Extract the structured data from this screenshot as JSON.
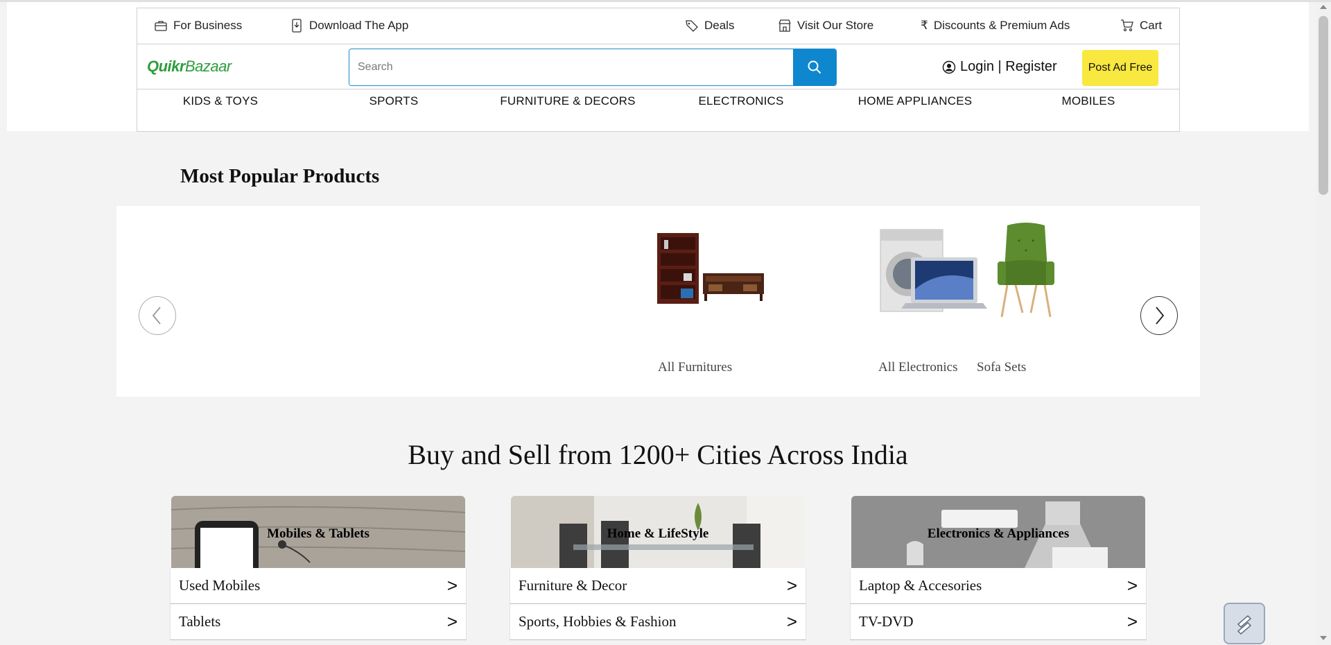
{
  "utility_bar": {
    "for_business": "For Business",
    "download_app": "Download The App",
    "deals": "Deals",
    "visit_store": "Visit Our Store",
    "discounts": "Discounts & Premium Ads",
    "cart": "Cart"
  },
  "header": {
    "logo_quikr": "Quikr",
    "logo_bazaar": "Bazaar",
    "search_placeholder": "Search",
    "login_label": "Login | Register",
    "post_ad_label": "Post Ad Free"
  },
  "category_nav": [
    "KIDS & TOYS",
    "SPORTS",
    "FURNITURE & DECORS",
    "ELECTRONICS",
    "HOME APPLIANCES",
    "MOBILES"
  ],
  "popular": {
    "title": "Most Popular Products",
    "products": [
      "All Furnitures",
      "All Electronics",
      "Sofa Sets"
    ]
  },
  "cities_heading": "Buy and Sell from 1200+ Cities Across India",
  "cards": [
    {
      "title": "Mobiles & Tablets",
      "rows": [
        "Used Mobiles",
        "Tablets"
      ]
    },
    {
      "title": "Home & LifeStyle",
      "rows": [
        "Furniture & Decor",
        "Sports, Hobbies & Fashion"
      ]
    },
    {
      "title": "Electronics & Appliances",
      "rows": [
        "Laptop & Accesories",
        "TV-DVD"
      ]
    }
  ],
  "colors": {
    "accent_blue": "#0f87cf",
    "post_ad_yellow": "#f8e83f",
    "logo_green": "#2e9c3c"
  }
}
